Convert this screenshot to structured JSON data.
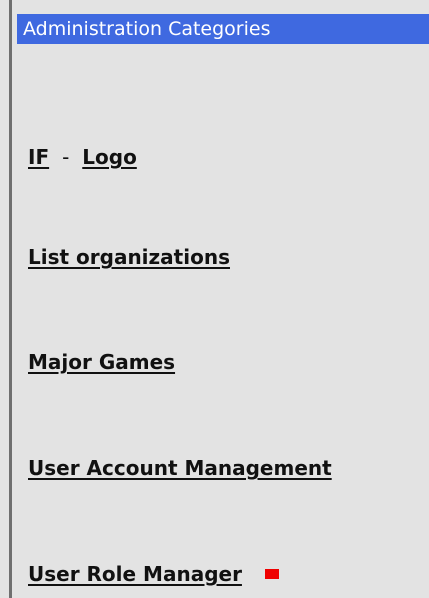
{
  "header": {
    "title": "Administration Categories"
  },
  "categories": {
    "if_label": "IF",
    "separator": "-",
    "logo_label": "Logo",
    "list_organizations": "List organizations",
    "major_games": "Major Games",
    "user_account_management": "User Account Management",
    "user_role_manager": "User Role Manager"
  },
  "colors": {
    "header_bg": "#3f69e0",
    "page_bg": "#e3e3e3",
    "marker": "#ef0000"
  }
}
